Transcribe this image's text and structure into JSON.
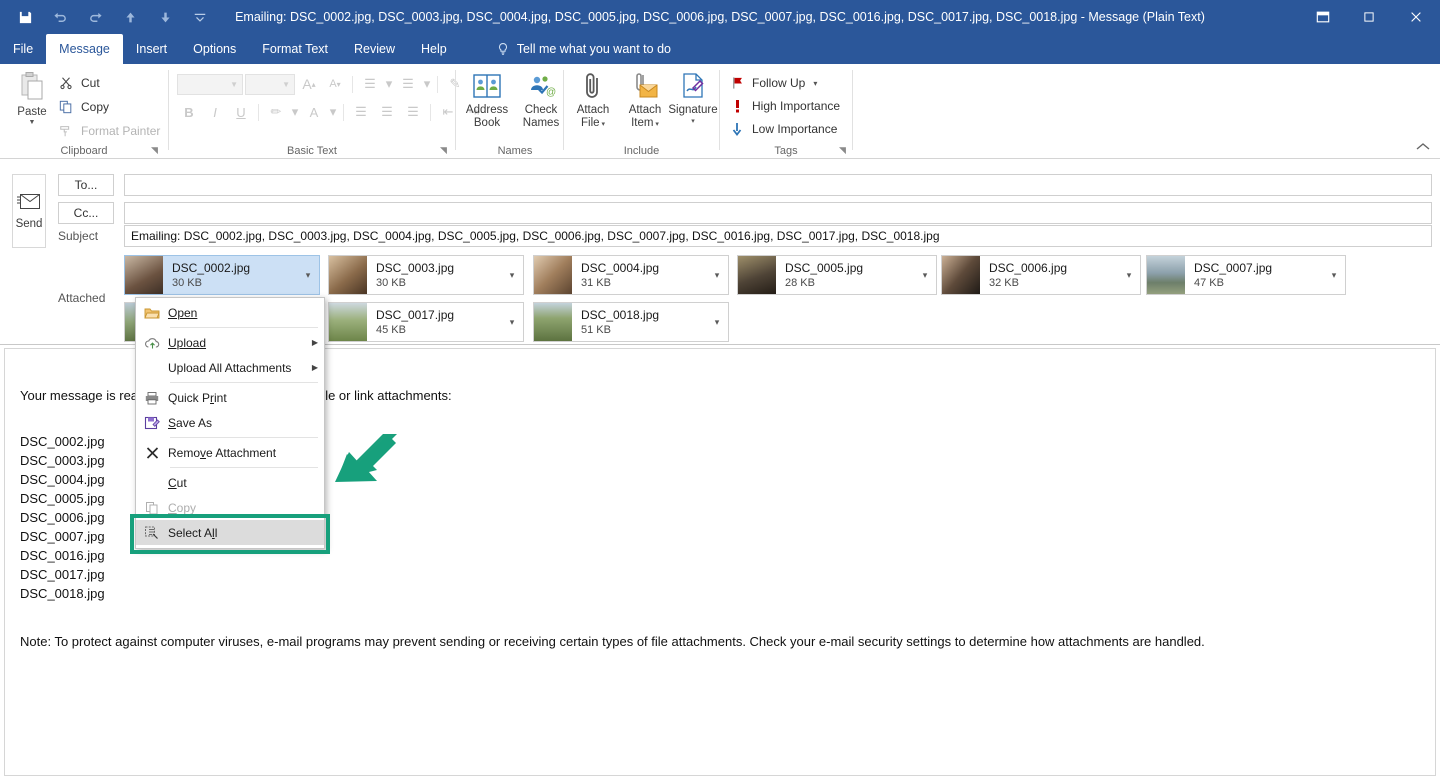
{
  "window": {
    "title": "Emailing: DSC_0002.jpg, DSC_0003.jpg, DSC_0004.jpg, DSC_0005.jpg, DSC_0006.jpg, DSC_0007.jpg, DSC_0016.jpg, DSC_0017.jpg, DSC_0018.jpg  -  Message (Plain Text)",
    "accent_color": "#2b579a",
    "controls": {
      "ribbon_display_options": "ribbon-display-options",
      "maximize": "maximize",
      "close": "close"
    }
  },
  "quick_access": {
    "save": "Save",
    "undo": "Undo",
    "redo": "Redo",
    "previous_item": "Previous Item",
    "next_item": "Next Item",
    "customize": "Customize Quick Access Toolbar"
  },
  "tabs": [
    {
      "label": "File",
      "active": false
    },
    {
      "label": "Message",
      "active": true
    },
    {
      "label": "Insert",
      "active": false
    },
    {
      "label": "Options",
      "active": false
    },
    {
      "label": "Format Text",
      "active": false
    },
    {
      "label": "Review",
      "active": false
    },
    {
      "label": "Help",
      "active": false
    }
  ],
  "tell_me": {
    "label": "Tell me what you want to do"
  },
  "ribbon": {
    "clipboard": {
      "group_label": "Clipboard",
      "paste": "Paste",
      "cut": "Cut",
      "copy": "Copy",
      "format_painter": "Format Painter"
    },
    "basic_text": {
      "group_label": "Basic Text",
      "font_name": "",
      "font_size": "",
      "grow_font": "A",
      "shrink_font": "A",
      "bold": "B",
      "italic": "I",
      "underline": "U",
      "font_color": "A"
    },
    "names": {
      "group_label": "Names",
      "address_book": "Address\nBook",
      "address_book_line1": "Address",
      "address_book_line2": "Book",
      "check_names_line1": "Check",
      "check_names_line2": "Names"
    },
    "include": {
      "group_label": "Include",
      "attach_file_line1": "Attach",
      "attach_file_line2": "File",
      "attach_item_line1": "Attach",
      "attach_item_line2": "Item",
      "signature_line1": "Signature",
      "signature_line2": ""
    },
    "tags": {
      "group_label": "Tags",
      "follow_up": "Follow Up",
      "high_importance": "High Importance",
      "low_importance": "Low Importance"
    }
  },
  "compose": {
    "send_label": "Send",
    "to_label": "To...",
    "cc_label": "Cc...",
    "to_value": "",
    "cc_value": "",
    "subject_label": "Subject",
    "subject_value": "Emailing: DSC_0002.jpg, DSC_0003.jpg, DSC_0004.jpg, DSC_0005.jpg, DSC_0006.jpg, DSC_0007.jpg, DSC_0016.jpg, DSC_0017.jpg, DSC_0018.jpg",
    "attached_label": "Attached"
  },
  "attachments": [
    {
      "name": "DSC_0002.jpg",
      "size": "30 KB",
      "selected": true,
      "row": 0,
      "col": 0,
      "thumb": "#7c6a58"
    },
    {
      "name": "DSC_0003.jpg",
      "size": "30 KB",
      "selected": false,
      "row": 0,
      "col": 1,
      "thumb": "#8a6f56"
    },
    {
      "name": "DSC_0004.jpg",
      "size": "31 KB",
      "selected": false,
      "row": 0,
      "col": 2,
      "thumb": "#a08564"
    },
    {
      "name": "DSC_0005.jpg",
      "size": "28 KB",
      "selected": false,
      "row": 0,
      "col": 3,
      "thumb": "#5e4a3c"
    },
    {
      "name": "DSC_0006.jpg",
      "size": "32 KB",
      "selected": false,
      "row": 0,
      "col": 4,
      "thumb": "#6b5a4a"
    },
    {
      "name": "DSC_0007.jpg",
      "size": "47 KB",
      "selected": false,
      "row": 0,
      "col": 5,
      "thumb": "#8ba0ac"
    },
    {
      "name": "DSC_0016.jpg",
      "size": "",
      "selected": false,
      "row": 1,
      "col": 0,
      "thumb": "#7e8f6a",
      "obscured": true
    },
    {
      "name": "DSC_0017.jpg",
      "size": "45 KB",
      "selected": false,
      "row": 1,
      "col": 1,
      "thumb": "#7f9363"
    },
    {
      "name": "DSC_0018.jpg",
      "size": "51 KB",
      "selected": false,
      "row": 1,
      "col": 2,
      "thumb": "#76895c"
    }
  ],
  "body": {
    "intro": "Your message is ready to be sent with the following file or link attachments:",
    "file_list": [
      "DSC_0002.jpg",
      "DSC_0003.jpg",
      "DSC_0004.jpg",
      "DSC_0005.jpg",
      "DSC_0006.jpg",
      "DSC_0007.jpg",
      "DSC_0016.jpg",
      "DSC_0017.jpg",
      "DSC_0018.jpg"
    ],
    "note": "Note: To protect against computer viruses, e-mail programs may prevent sending or receiving certain types of file attachments.  Check your e-mail security settings to determine how attachments are handled."
  },
  "context_menu": {
    "highlight_color": "#17a07c",
    "items": [
      {
        "label": "Open",
        "icon": "folder-open-icon",
        "disabled": false,
        "submenu": false,
        "divider_after": true,
        "highlighted": false
      },
      {
        "label": "Upload",
        "icon": "cloud-upload-icon",
        "disabled": false,
        "submenu": true,
        "divider_after": false,
        "highlighted": false
      },
      {
        "label": "Upload All Attachments",
        "icon": "none",
        "disabled": false,
        "submenu": true,
        "divider_after": true,
        "highlighted": false
      },
      {
        "label": "Quick Print",
        "icon": "printer-icon",
        "disabled": false,
        "submenu": false,
        "divider_after": false,
        "highlighted": false
      },
      {
        "label": "Save As",
        "icon": "save-as-icon",
        "disabled": false,
        "submenu": false,
        "divider_after": true,
        "highlighted": false
      },
      {
        "label": "Remove Attachment",
        "icon": "remove-x-icon",
        "disabled": false,
        "submenu": false,
        "divider_after": true,
        "highlighted": false
      },
      {
        "label": "Cut",
        "icon": "none",
        "disabled": false,
        "submenu": false,
        "divider_after": false,
        "highlighted": false
      },
      {
        "label": "Copy",
        "icon": "copy-icon",
        "disabled": true,
        "submenu": false,
        "divider_after": false,
        "highlighted": false
      },
      {
        "label": "Select All",
        "icon": "select-all-icon",
        "disabled": false,
        "submenu": false,
        "divider_after": false,
        "highlighted": true
      }
    ]
  },
  "annotation": {
    "arrow_color": "#17a07c",
    "points_to": "Select All"
  }
}
